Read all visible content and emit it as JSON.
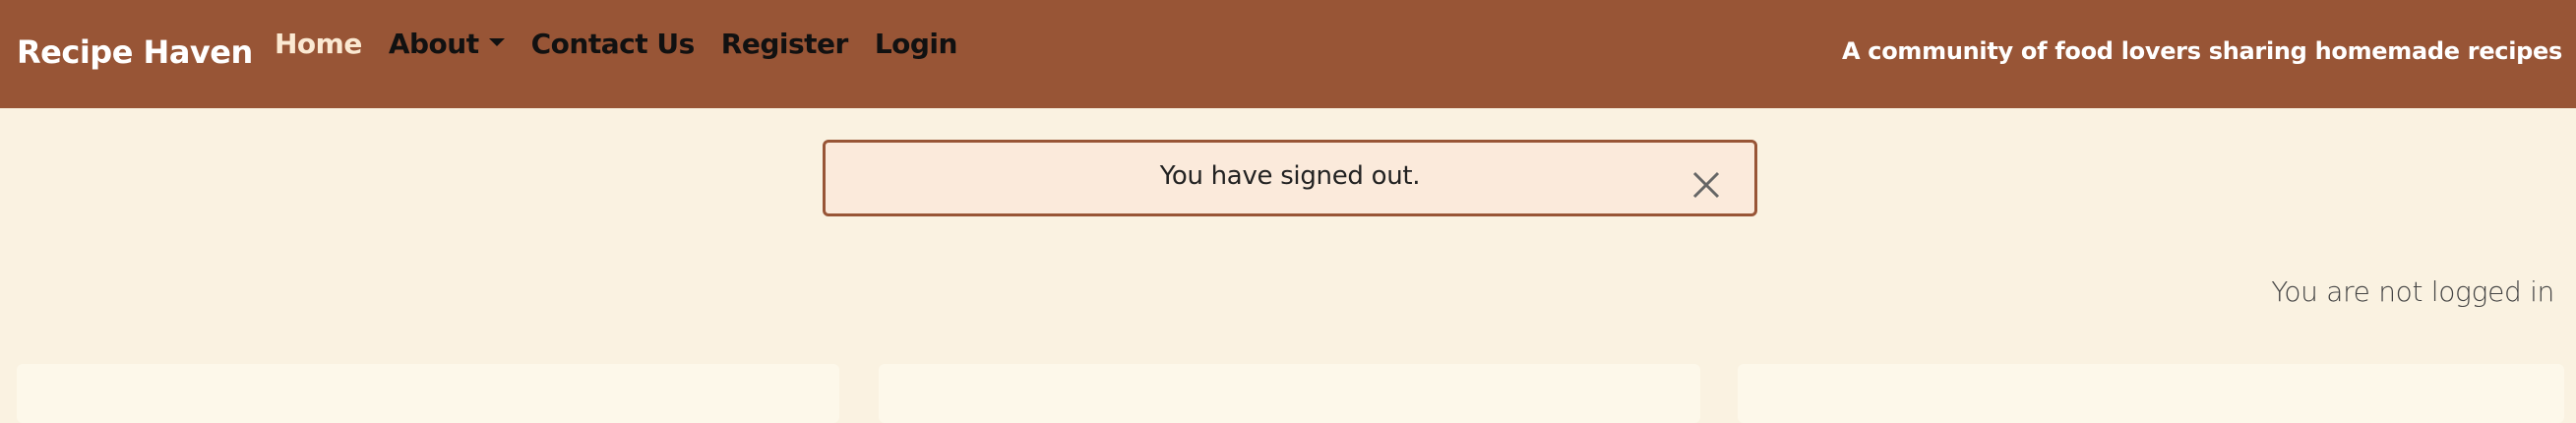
{
  "navbar": {
    "brand": "Recipe Haven",
    "links": [
      {
        "label": "Home",
        "active": true
      },
      {
        "label": "About",
        "dropdown": true
      },
      {
        "label": "Contact Us"
      },
      {
        "label": "Register"
      },
      {
        "label": "Login"
      }
    ],
    "tagline": "A community of food lovers sharing homemade recipes"
  },
  "alert": {
    "message": "You have signed out.",
    "close_icon": "close-icon"
  },
  "status": {
    "login_text": "You are not logged in"
  },
  "colors": {
    "navbar_bg": "#985536",
    "page_bg": "#faf2e1",
    "alert_bg": "#fbeadb",
    "alert_border": "#985536",
    "card_bg": "#fdf8ea",
    "active_link": "#fbe9d2"
  }
}
